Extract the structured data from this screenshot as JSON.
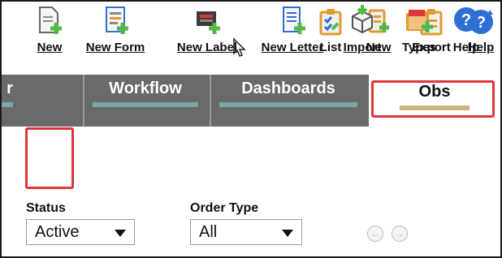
{
  "top_toolbar": {
    "list_label": "List",
    "new_label": "New",
    "export_label": "Export",
    "help_label": "Help"
  },
  "tabs": [
    {
      "label": "r"
    },
    {
      "label": "Workflow"
    },
    {
      "label": "Dashboards"
    },
    {
      "label": "Obs"
    }
  ],
  "actions": {
    "new": "New",
    "new_form": "New Form",
    "new_label": "New Label",
    "new_letter": "New Letter",
    "import": "Import",
    "types": "Types",
    "help": "Help"
  },
  "filters": {
    "status_label": "Status",
    "status_value": "Active",
    "order_type_label": "Order Type",
    "order_type_value": "All"
  },
  "colors": {
    "tab_bg": "#6a6a6a",
    "tab_indicator": "#7aa6a8",
    "active_indicator": "#cdb679",
    "highlight": "#e0353a",
    "help_blue": "#2f6fd6",
    "add_green": "#54b848"
  }
}
